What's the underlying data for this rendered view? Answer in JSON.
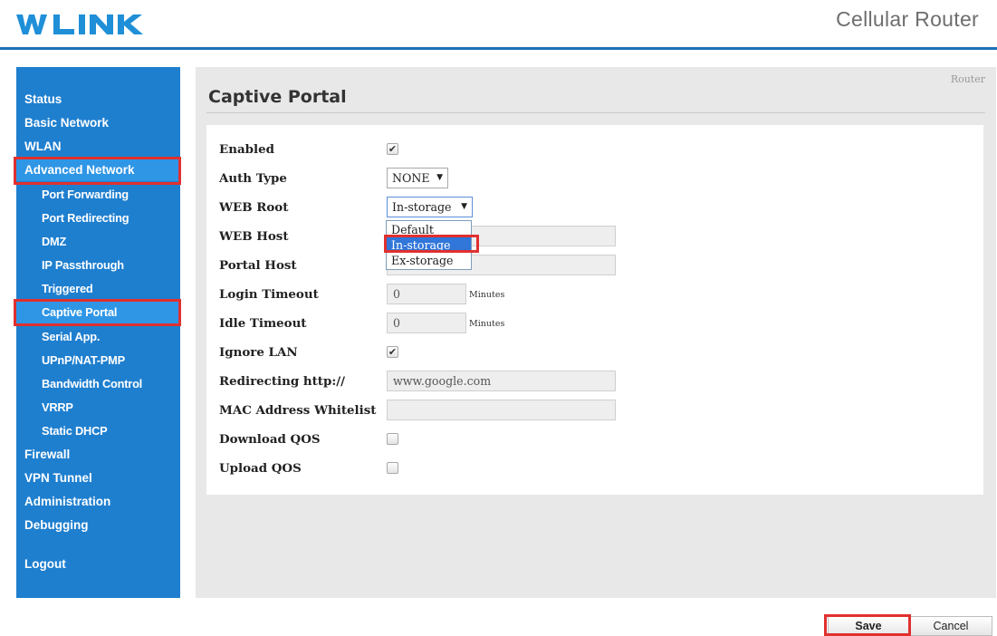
{
  "header": {
    "logo_text": "WLINK",
    "product": "Cellular Router",
    "accent_color": "#1b6fb8",
    "logo_color": "#1f8fd8"
  },
  "sidebar": {
    "bg_color": "#1f7fcf",
    "items": [
      {
        "label": "Status"
      },
      {
        "label": "Basic Network"
      },
      {
        "label": "WLAN"
      },
      {
        "label": "Advanced Network"
      },
      {
        "label": "Port Forwarding"
      },
      {
        "label": "Port Redirecting"
      },
      {
        "label": "DMZ"
      },
      {
        "label": "IP Passthrough"
      },
      {
        "label": "Triggered"
      },
      {
        "label": "Captive Portal"
      },
      {
        "label": "Serial App."
      },
      {
        "label": "UPnP/NAT-PMP"
      },
      {
        "label": "Bandwidth Control"
      },
      {
        "label": "VRRP"
      },
      {
        "label": "Static DHCP"
      },
      {
        "label": "Firewall"
      },
      {
        "label": "VPN Tunnel"
      },
      {
        "label": "Administration"
      },
      {
        "label": "Debugging"
      },
      {
        "label": "Logout"
      }
    ],
    "active_item": "Captive Portal",
    "highlight_color": "#e0302f"
  },
  "main": {
    "breadcrumb": "Router",
    "title": "Captive Portal",
    "fields": {
      "enabled": {
        "label": "Enabled",
        "checked": true
      },
      "auth_type": {
        "label": "Auth Type",
        "value": "NONE"
      },
      "web_root": {
        "label": "WEB Root",
        "value": "In-storage",
        "options": [
          "Default",
          "In-storage",
          "Ex-storage"
        ],
        "highlighted_option": "In-storage"
      },
      "web_host": {
        "label": "WEB Host",
        "value": ""
      },
      "portal_host": {
        "label": "Portal Host",
        "value": ""
      },
      "login_timeout": {
        "label": "Login Timeout",
        "value": "0",
        "unit": "Minutes"
      },
      "idle_timeout": {
        "label": "Idle Timeout",
        "value": "0",
        "unit": "Minutes"
      },
      "ignore_lan": {
        "label": "Ignore LAN",
        "checked": true
      },
      "redirecting": {
        "label": "Redirecting http://",
        "value": "www.google.com"
      },
      "mac_whitelist": {
        "label": "MAC Address Whitelist",
        "value": ""
      },
      "download_qos": {
        "label": "Download QOS",
        "checked": false
      },
      "upload_qos": {
        "label": "Upload QOS",
        "checked": false
      }
    },
    "check_mark": "✔",
    "dropdown_arrow": "▼"
  },
  "footer": {
    "save_label": "Save",
    "cancel_label": "Cancel"
  }
}
